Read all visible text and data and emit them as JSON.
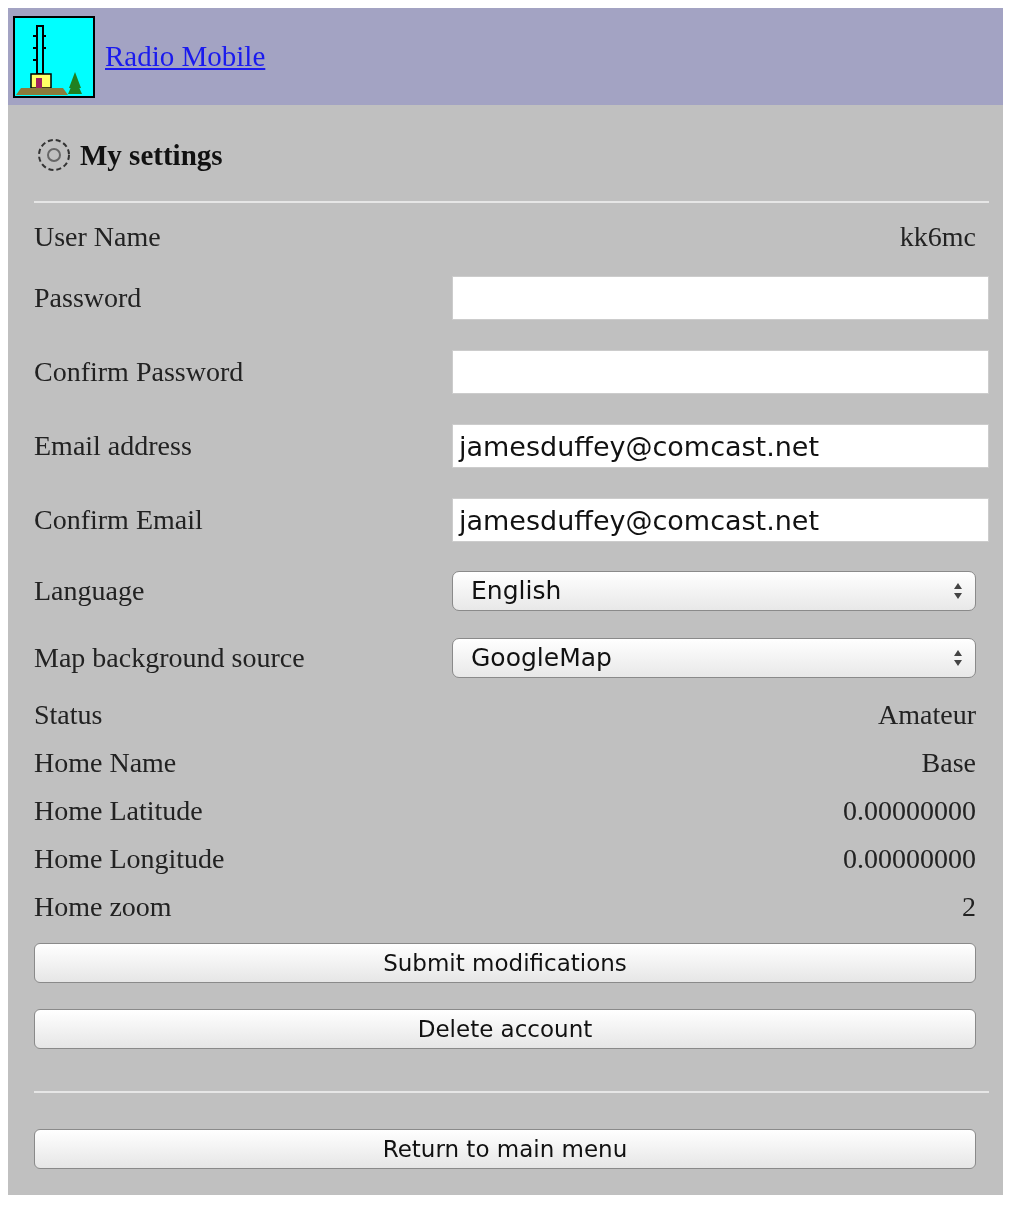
{
  "header": {
    "title": "Radio Mobile"
  },
  "section": {
    "title": "My settings"
  },
  "fields": [
    {
      "kind": "text",
      "label": "User Name",
      "value": "kk6mc"
    },
    {
      "kind": "input",
      "label": "Password"
    },
    {
      "kind": "input",
      "label": "Confirm Password"
    },
    {
      "kind": "input",
      "label": "Email address",
      "value": "jamesduffey@comcast.net"
    },
    {
      "kind": "input",
      "label": "Confirm Email",
      "value": "jamesduffey@comcast.net"
    },
    {
      "kind": "select",
      "label": "Language",
      "value": "English"
    },
    {
      "kind": "select",
      "label": "Map background source",
      "value": "GoogleMap"
    },
    {
      "kind": "text",
      "label": "Status",
      "value": "Amateur"
    },
    {
      "kind": "text",
      "label": "Home Name",
      "value": "Base"
    },
    {
      "kind": "text",
      "label": "Home Latitude",
      "value": "0.00000000"
    },
    {
      "kind": "text",
      "label": "Home Longitude",
      "value": "0.00000000"
    },
    {
      "kind": "text",
      "label": "Home zoom",
      "value": "2"
    }
  ],
  "buttons": [
    "Submit modifications",
    "Delete account"
  ],
  "footer_button": "Return to main menu"
}
